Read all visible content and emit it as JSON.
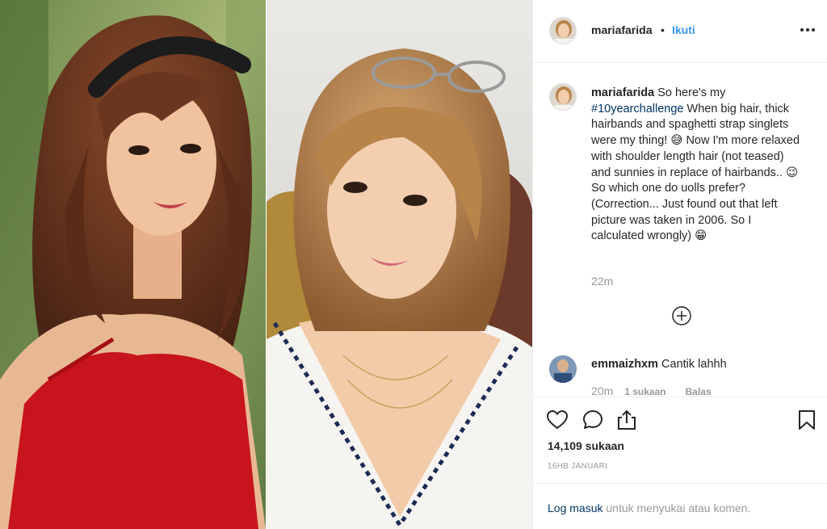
{
  "post": {
    "username": "mariafarida",
    "separator": "•",
    "follow_label": "Ikuti",
    "more_icon": "more-horizontal-icon"
  },
  "caption": {
    "username": "mariafarida",
    "text_before_hashtag": "So here's my",
    "hashtag": "#10yearchallenge",
    "text_after_hashtag": "When big hair, thick hairbands and spaghetti strap singlets were my thing! 😅 Now I'm more relaxed with shoulder length hair (not teased) and sunnies in replace of hairbands.. 😉 So which one do uolls prefer? (Correction... Just found out that left picture was taken in 2006. So I calculated wrongly) 😁",
    "time": "22m"
  },
  "load_more_icon": "plus-circle-icon",
  "comments": [
    {
      "username": "emmaizhxm",
      "text": "Cantik lahhh",
      "time": "20m",
      "likes": "1 sukaan",
      "reply_label": "Balas"
    }
  ],
  "actions": {
    "icons": [
      "heart-icon",
      "comment-icon",
      "share-icon",
      "bookmark-icon"
    ]
  },
  "likes_count": "14,109 sukaan",
  "post_date": "16HB JANUARI",
  "footer": {
    "login_link": "Log masuk",
    "login_suffix": "untuk menyukai atau komen."
  },
  "colors": {
    "link_blue": "#3897f0",
    "hashtag_navy": "#003569",
    "muted_gray": "#999999",
    "text_dark": "#262626",
    "border": "#efefef"
  }
}
